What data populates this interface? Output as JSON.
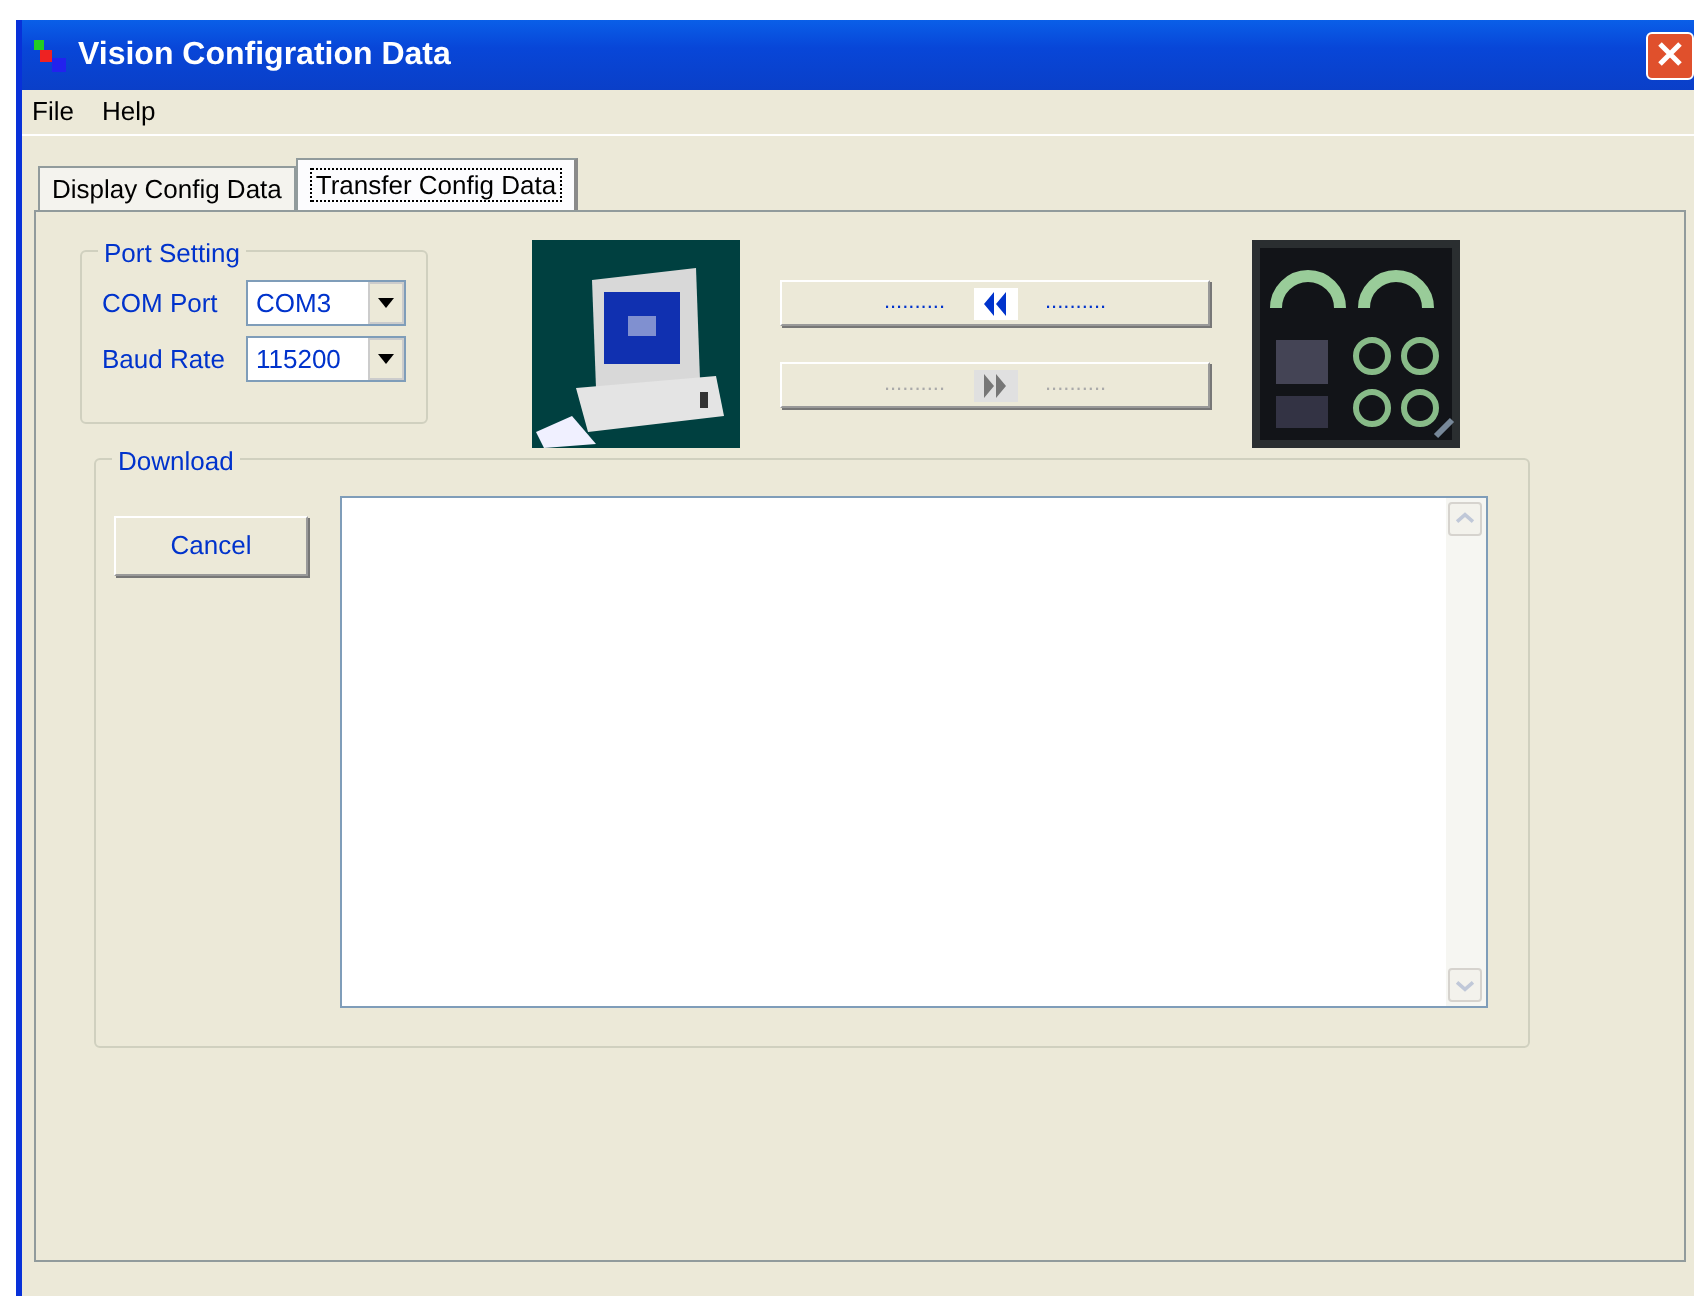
{
  "window": {
    "title": "Vision Configration Data"
  },
  "menu": [
    "File",
    "Help"
  ],
  "tabs": [
    {
      "label": "Display Config Data",
      "selected": false
    },
    {
      "label": "Transfer Config Data",
      "selected": true
    }
  ],
  "port_setting": {
    "title": "Port Setting",
    "fields": [
      {
        "label": "COM Port",
        "value": "COM3"
      },
      {
        "label": "Baud Rate",
        "value": "115200"
      }
    ]
  },
  "transfer_buttons": [
    {
      "kind": "rewind",
      "left_text": "..........",
      "right_text": "..........",
      "disabled": false
    },
    {
      "kind": "forward",
      "left_text": "..........",
      "right_text": "..........",
      "disabled": true
    }
  ],
  "download": {
    "title": "Download",
    "button": "Cancel"
  }
}
